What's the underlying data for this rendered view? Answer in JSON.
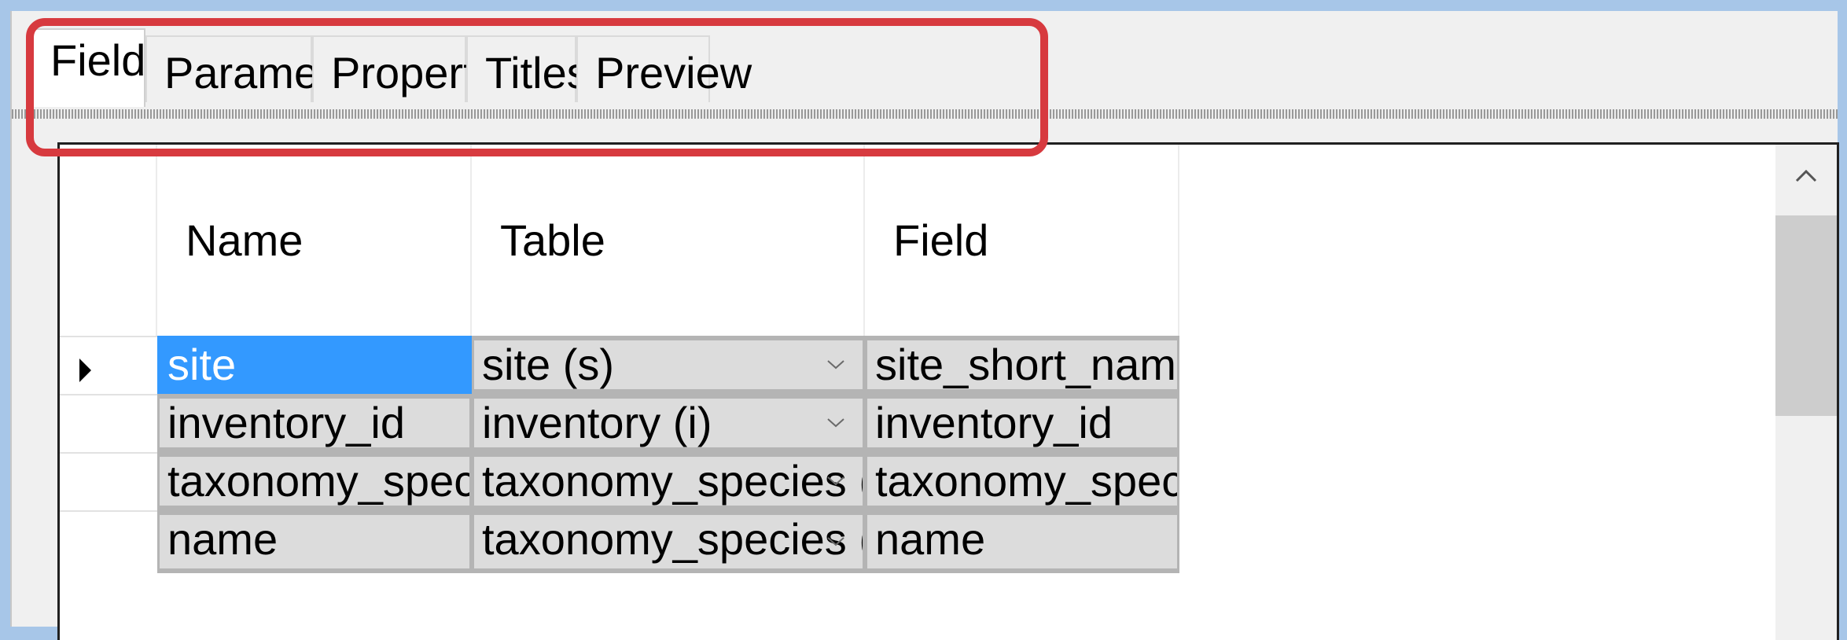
{
  "tabs": [
    {
      "label": "Fields",
      "active": true
    },
    {
      "label": "Parameters",
      "active": false
    },
    {
      "label": "Properties",
      "active": false
    },
    {
      "label": "Titles",
      "active": false
    },
    {
      "label": "Preview",
      "active": false
    }
  ],
  "grid": {
    "columns": [
      "Name",
      "Table",
      "Field"
    ],
    "rows": [
      {
        "name": "site",
        "table": "site (s)",
        "field": "site_short_name",
        "current": true
      },
      {
        "name": "inventory_id",
        "table": "inventory (i)",
        "field": "inventory_id",
        "current": false
      },
      {
        "name": "taxonomy_species_id",
        "table": "taxonomy_species (t)",
        "field": "taxonomy_species_id",
        "current": false
      },
      {
        "name": "name",
        "table": "taxonomy_species (t)",
        "field": "name",
        "current": false
      }
    ]
  },
  "colors": {
    "highlight": "#d73a3f",
    "selection": "#3399ff",
    "background": "#a7c6e8"
  },
  "icons": {
    "current_row": "row-pointer-icon",
    "dropdown": "chevron-down-icon",
    "scroll_up": "chevron-up-icon"
  }
}
